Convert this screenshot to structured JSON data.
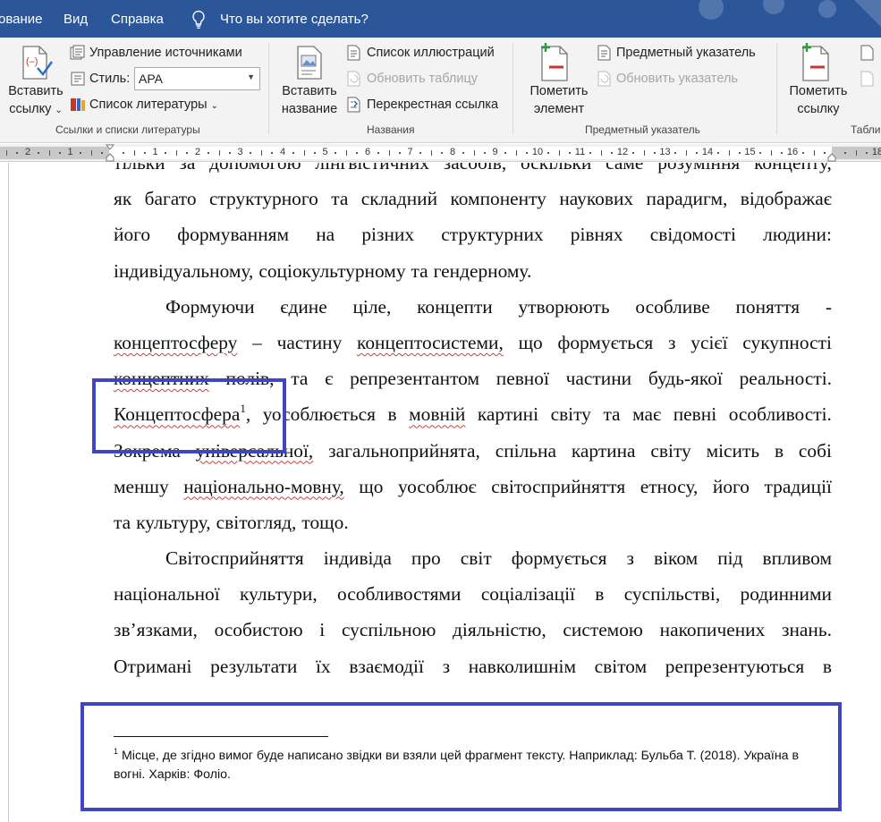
{
  "menubar": {
    "items": [
      "ование",
      "Вид",
      "Справка"
    ],
    "tell_me": "Что вы хотите сделать?"
  },
  "ribbon": {
    "insert_citation": [
      "Вставить",
      "ссылку"
    ],
    "manage_sources": "Управление источниками",
    "style_label": "Стиль:",
    "style_value": "APA",
    "bibliography": "Список литературы",
    "group_citations": "Ссылки и списки литературы",
    "insert_caption": [
      "Вставить",
      "название"
    ],
    "table_of_figures": "Список иллюстраций",
    "update_table": "Обновить таблицу",
    "cross_reference": "Перекрестная ссылка",
    "group_captions": "Названия",
    "mark_entry": [
      "Пометить",
      "элемент"
    ],
    "insert_index": "Предметный указатель",
    "update_index": "Обновить указатель",
    "group_index": "Предметный указатель",
    "mark_citation": [
      "Пометить",
      "ссылку"
    ],
    "group_table_auth": "Табли"
  },
  "ruler": {
    "numbers": [
      "2",
      "1",
      "1",
      "2",
      "3",
      "4",
      "5",
      "6",
      "7",
      "8",
      "9",
      "10",
      "11",
      "12",
      "13",
      "14",
      "15",
      "16",
      "18"
    ]
  },
  "document": {
    "lines": [
      [
        "тільки",
        "за",
        "допомогою",
        "лінгвістичних",
        "засобів,",
        "оскільки",
        "саме",
        "розуміння",
        "концепту,"
      ],
      [
        "як",
        "багато",
        "структурного",
        "та",
        "складний",
        "компоненту",
        "наукових",
        "парадигм,",
        "відображає"
      ],
      [
        "його",
        "формуванням",
        "на",
        "різних",
        "структурних",
        "рівнях",
        "свідомості",
        "людини:"
      ],
      [
        "індивідуальному,",
        "соціокультурному",
        "та",
        "гендерному."
      ],
      [
        "Формуючи",
        "єдине",
        "ціле,",
        "концепти",
        "утворюють",
        "особливе",
        "поняття",
        "-"
      ],
      [
        "концептосферу",
        "–",
        "частину",
        "концептосистеми,",
        "що",
        "формується",
        "з",
        "усієї",
        "сукупності"
      ],
      [
        "концептних",
        "полів,",
        "та",
        "є",
        "репрезентантом",
        "певної",
        "частини",
        "будь-якої",
        "реальності."
      ],
      [
        "Концептосфера",
        "1",
        ",",
        "уособлюється",
        "в",
        "мовній",
        "картині",
        "світу",
        "та",
        "має",
        "певні",
        "особливості."
      ],
      [
        "Зокрема",
        "універсальної,",
        "загальноприйнята,",
        "спільна",
        "картина",
        "світу",
        "місить",
        "в",
        "собі"
      ],
      [
        "меншу",
        "національно-мовну,",
        "що",
        "уособлює",
        "світосприйняття",
        "етносу,",
        "його",
        "традиції"
      ],
      [
        "та",
        "культуру,",
        "світогляд,",
        "тощо."
      ],
      [
        "Світосприйняття",
        "індивіда",
        "про",
        "світ",
        "формується",
        "з",
        "віком",
        "під",
        "впливом"
      ],
      [
        "національної",
        "культури,",
        "особливостями",
        "соціалізації",
        "в",
        "суспільстві,",
        "родинними"
      ],
      [
        "зв’язками,",
        "особистою",
        "і",
        "суспільною",
        "діяльністю,",
        "системою",
        "накопичених",
        "знань."
      ],
      [
        "Отримані",
        "результати",
        "їх",
        "взаємодії",
        "з",
        "навколишнім",
        "світом",
        "репрезентуються",
        "в"
      ]
    ],
    "footnote": {
      "marker": "1",
      "text": "Місце, де згідно вимог буде написано звідки ви взяли цей фрагмент тексту. Наприклад: Бульба Т. (2018). Україна в вогні. Харків: Фоліо."
    }
  },
  "annotation_color": "#4145c0",
  "menubar_color": "#2b579a"
}
